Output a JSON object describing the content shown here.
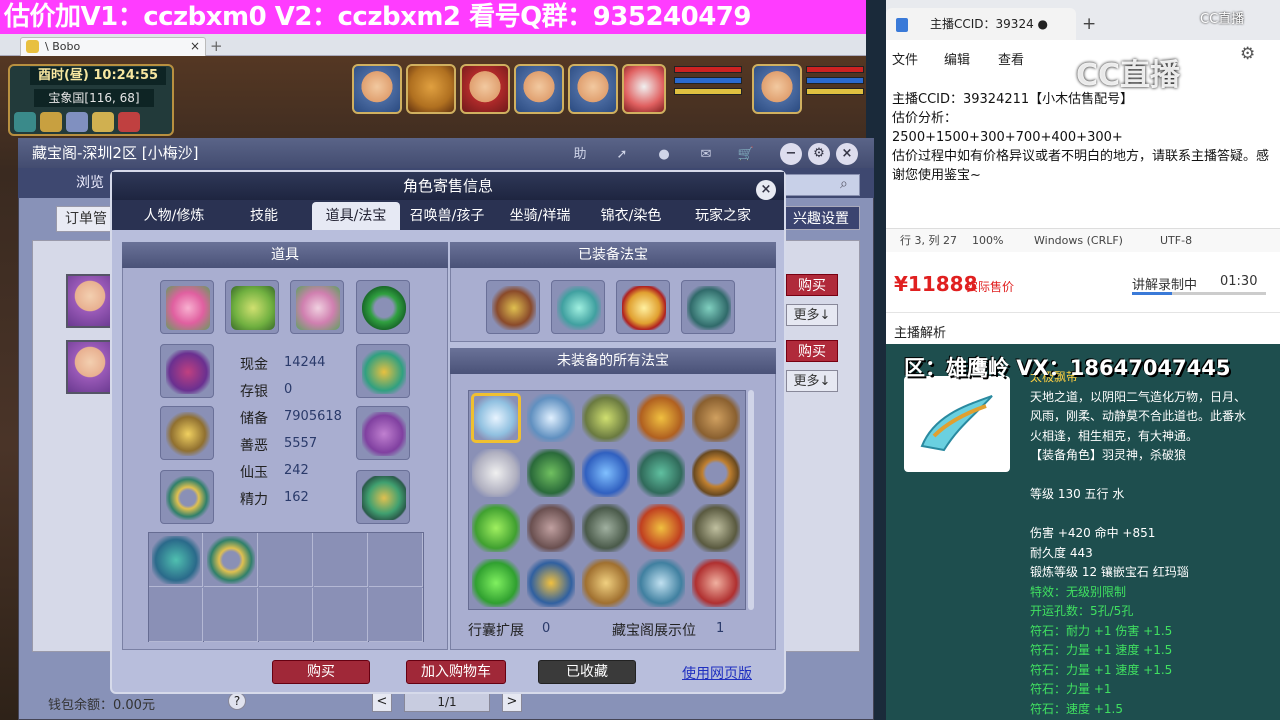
{
  "banner": "估价加V1：cczbxm0    V2：cczbxm2   看号Q群：935240479",
  "browser": {
    "tab_title": "\\ Bobo",
    "close": "×",
    "plus": "+"
  },
  "hud": {
    "time": "酉时(昼)  10:24:55",
    "location": "宝象国[116, 68]"
  },
  "main_window": {
    "title": "藏宝阁-深圳2区 [小梅沙]",
    "header_icons": [
      "助",
      "➚",
      "●",
      "✉",
      "🛒"
    ],
    "browse_label": "浏览",
    "order_tab": "订单管",
    "hobby_button": "兴趣设置",
    "rows": [
      {
        "buy": "购买",
        "more": "更多↓"
      },
      {
        "buy": "购买",
        "more": "更多↓"
      }
    ],
    "wallet": "钱包余额：0.00元",
    "help": "?",
    "page": "1/1",
    "prev": "<",
    "next": ">"
  },
  "dialog": {
    "title": "角色寄售信息",
    "close": "×",
    "tabs": [
      "人物/修炼",
      "技能",
      "道具/法宝",
      "召唤兽/孩子",
      "坐骑/祥瑞",
      "锦衣/染色",
      "玩家之家"
    ],
    "active_tab": 2,
    "items_header": "道具",
    "stats": [
      {
        "label": "现金",
        "value": "14244"
      },
      {
        "label": "存银",
        "value": "0"
      },
      {
        "label": "储备",
        "value": "7905618"
      },
      {
        "label": "善恶",
        "value": "5557"
      },
      {
        "label": "仙玉",
        "value": "242"
      },
      {
        "label": "精力",
        "value": "162"
      }
    ],
    "equipped_header": "已装备法宝",
    "unequipped_header": "未装备的所有法宝",
    "bag_expand_label": "行囊扩展",
    "bag_expand_value": "0",
    "display_label": "藏宝阁展示位",
    "display_value": "1",
    "buttons": {
      "buy": "购买",
      "add_cart": "加入购物车",
      "collected": "已收藏",
      "web_version": "使用网页版"
    }
  },
  "notepad": {
    "tab_title": "主播CCID：39324",
    "tab_dot": "●",
    "tab_plus": "+",
    "menu": [
      "文件",
      "编辑",
      "查看"
    ],
    "lines": [
      "主播CCID：39324211【小木估售配号】",
      "估价分析：",
      "2500+1500+300+700+400+300+",
      "估价过程中如有价格异议或者不明白的地方，请联系主播答疑。感谢您使用鉴宝~"
    ],
    "status": [
      "行 3, 列 27",
      "100%",
      "Windows (CRLF)",
      "UTF-8"
    ]
  },
  "watermark": {
    "logo": "CC直播",
    "top": "CC直播"
  },
  "price": {
    "amount": "¥11888",
    "label": "实际售价",
    "recording": "讲解录制中",
    "recording_time": "01:30",
    "anchor_analysis": "主播解析"
  },
  "overlay": {
    "region": "区：雄鹰岭  VX：18647047445"
  },
  "item_detail": {
    "name": "太极飘带",
    "lines": [
      "天地之道，以阴阳二气造化万物，日月、",
      "风雨，刚柔、动静莫不合此道也。此番水",
      "火相逢，相生相克，有大神通。",
      "【装备角色】羽灵神，杀破狼",
      "",
      "等级 130 五行 水",
      "",
      "伤害 +420 命中 +851",
      "耐久度 443",
      "锻炼等级 12 镶嵌宝石 红玛瑙"
    ],
    "green_lines": [
      "特效：无级别限制",
      "开运孔数：5孔/5孔",
      "符石：耐力 +1 伤害 +1.5",
      "符石：力量 +1 速度 +1.5",
      "符石：力量 +1 速度 +1.5",
      "符石：力量 +1",
      "符石：速度 +1.5"
    ]
  },
  "colors": {
    "banner": "#ff3cff",
    "buy": "#b02a3a",
    "price": "#e02020",
    "teal": "#1e4e4e",
    "green_text": "#40e060"
  }
}
